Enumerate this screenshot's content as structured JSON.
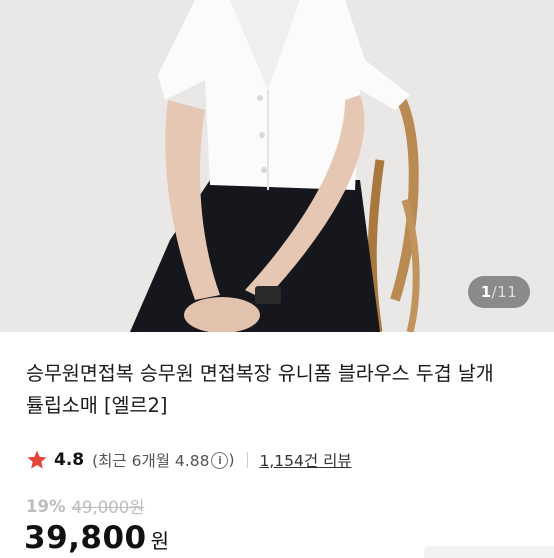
{
  "gallery": {
    "current": "1",
    "separator": "/",
    "total": "11"
  },
  "product": {
    "title": "승무원면접복 승무원 면접복장 유니폼 블라우스 두겹 날개 튤립소매 [엘르2]"
  },
  "rating": {
    "score": "4.8",
    "recent_label": "(최근 6개월 4.88",
    "recent_close": ")",
    "review_count": "1,154건 리뷰"
  },
  "price": {
    "discount": "19%",
    "original": "49,000원",
    "sale": "39,800",
    "currency": "원"
  },
  "icons": {
    "star": "star-icon",
    "info": "info-icon"
  },
  "colors": {
    "star": "#e8443a",
    "discount": "#bdbdbd",
    "text": "#111111"
  }
}
